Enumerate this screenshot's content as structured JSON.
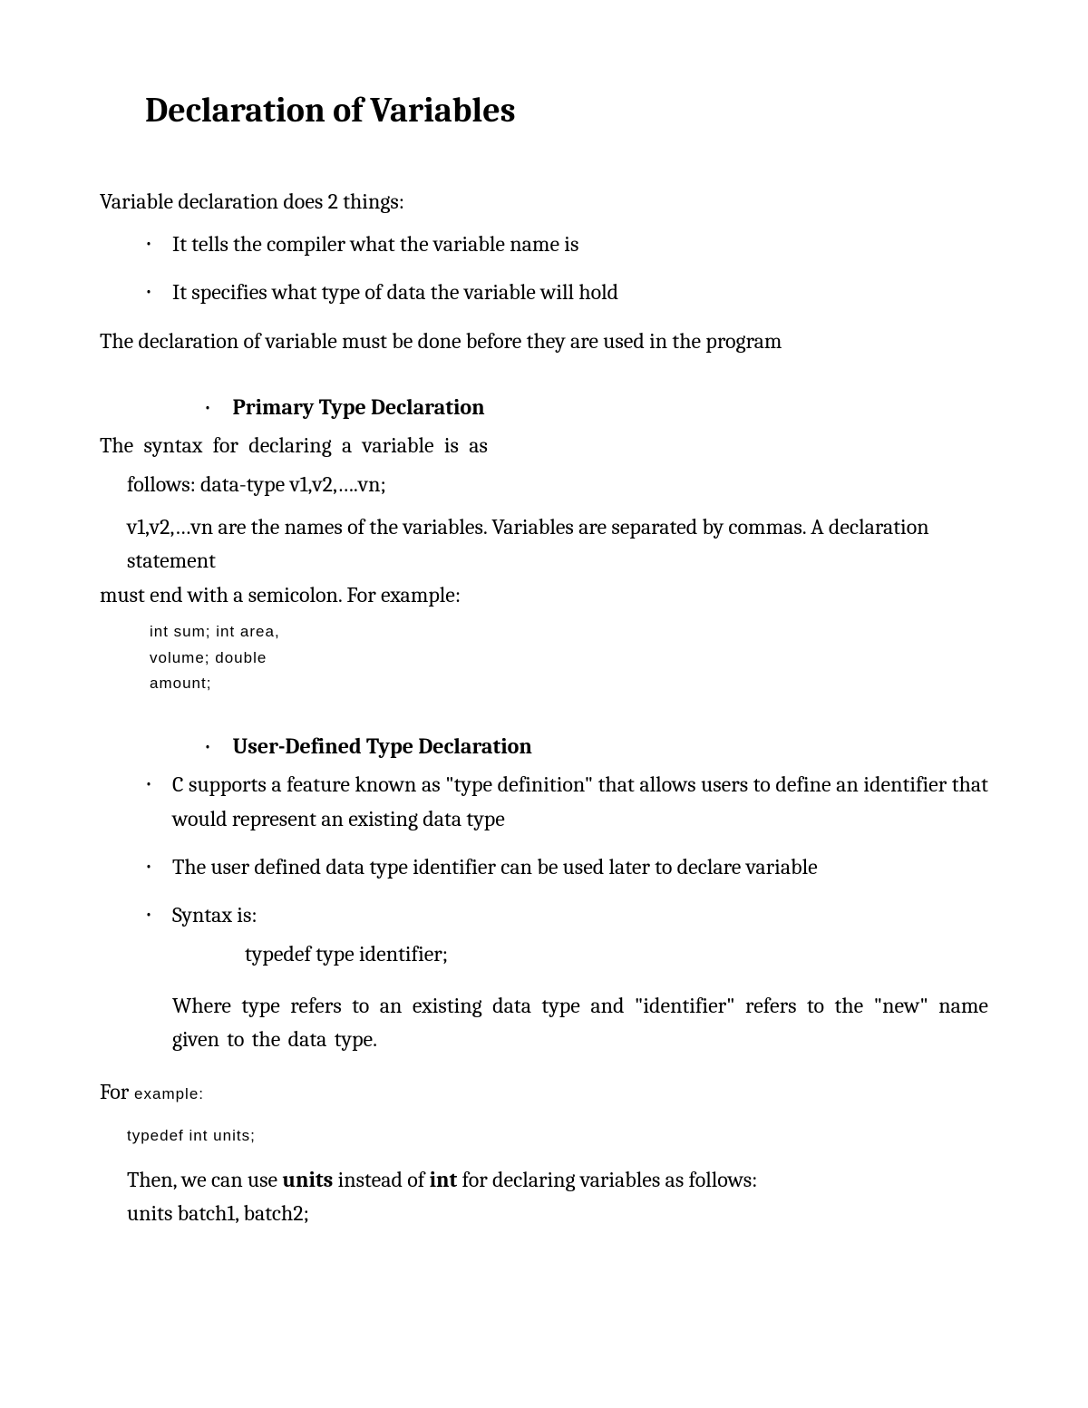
{
  "title": "Declaration of Variables",
  "intro": "Variable declaration does 2 things:",
  "intro_bullets": [
    "It tells the compiler what the variable name is",
    "It specifies what type of data the variable will hold"
  ],
  "intro_after": "The declaration of variable must be done before they are used in the program",
  "section1": {
    "heading": "Primary Type Declaration",
    "line1": "The syntax for declaring a variable is as",
    "line2": "follows: data-type v1,v2,….vn;",
    "line3": "v1,v2,…vn are the names of the variables. Variables are separated by commas. A declaration statement",
    "line4": "must end with a semicolon. For example:",
    "code": "int  sum;  int  area,\nvolume;       double\namount;"
  },
  "section2": {
    "heading": "User-Defined Type Declaration",
    "bullets": [
      {
        "text": "C supports a feature known as \"type definition\" that allows users to define an identifier that would represent an existing data type"
      },
      {
        "text": "The user defined data type identifier can be used later to declare variable"
      },
      {
        "text": "Syntax is:",
        "sub": "typedef type identifier;",
        "after": "Where type refers to an existing data type and \"identifier\" refers to the \"new\" name given to the data type."
      }
    ],
    "for_example_prefix": "For",
    "for_example_suffix": " example:",
    "code2": "typedef     int units;",
    "then_line_prefix": "Then, we can use ",
    "then_units": "units",
    "then_middle": " instead of ",
    "then_int": "int",
    "then_suffix": " for declaring variables as follows:",
    "units_line": "units batch1, batch2;"
  }
}
